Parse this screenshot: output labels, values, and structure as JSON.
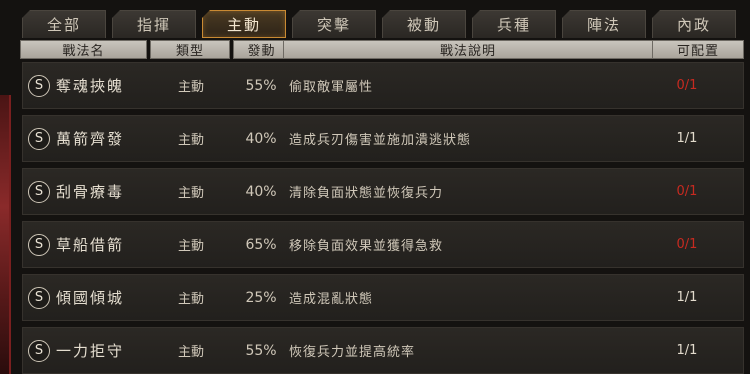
{
  "tabs": [
    {
      "label": "全部",
      "active": false
    },
    {
      "label": "指揮",
      "active": false
    },
    {
      "label": "主動",
      "active": true
    },
    {
      "label": "突擊",
      "active": false
    },
    {
      "label": "被動",
      "active": false
    },
    {
      "label": "兵種",
      "active": false
    },
    {
      "label": "陣法",
      "active": false
    },
    {
      "label": "內政",
      "active": false
    }
  ],
  "columns": {
    "name": "戰法名",
    "type": "類型",
    "rate": "發動",
    "desc": "戰法說明",
    "avail": "可配置"
  },
  "rows": [
    {
      "icon_letter": "S",
      "name": "奪魂挾魄",
      "type": "主動",
      "rate": "55%",
      "desc": "偷取敵軍屬性",
      "avail": "0/1",
      "avail_red": true
    },
    {
      "icon_letter": "S",
      "name": "萬箭齊發",
      "type": "主動",
      "rate": "40%",
      "desc": "造成兵刃傷害並施加潰逃狀態",
      "avail": "1/1",
      "avail_red": false
    },
    {
      "icon_letter": "S",
      "name": "刮骨療毒",
      "type": "主動",
      "rate": "40%",
      "desc": "清除負面狀態並恢復兵力",
      "avail": "0/1",
      "avail_red": true
    },
    {
      "icon_letter": "S",
      "name": "草船借箭",
      "type": "主動",
      "rate": "65%",
      "desc": "移除負面效果並獲得急救",
      "avail": "0/1",
      "avail_red": true
    },
    {
      "icon_letter": "S",
      "name": "傾國傾城",
      "type": "主動",
      "rate": "25%",
      "desc": "造成混亂狀態",
      "avail": "1/1",
      "avail_red": false
    },
    {
      "icon_letter": "S",
      "name": "一力拒守",
      "type": "主動",
      "rate": "55%",
      "desc": "恢復兵力並提高統率",
      "avail": "1/1",
      "avail_red": false
    }
  ],
  "colors": {
    "accent": "#c98a33",
    "unavailable": "#c62a20"
  }
}
